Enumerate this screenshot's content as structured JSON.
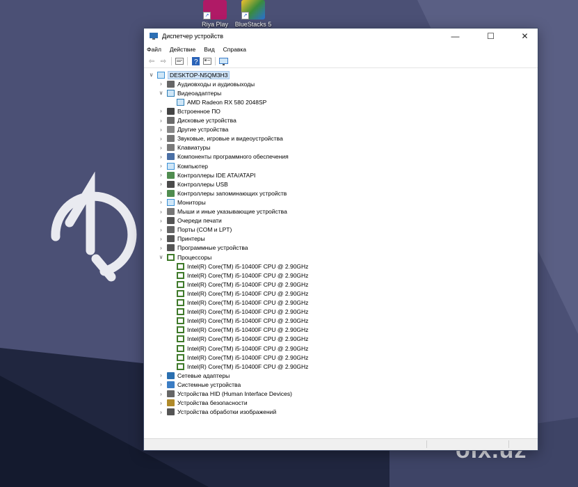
{
  "desktop": {
    "icons": [
      {
        "label": "Riya Play",
        "icon": "riya-play-icon",
        "color": "#b01a66"
      },
      {
        "label": "BlueStacks 5",
        "icon": "bluestacks-icon",
        "color": "#3b8c3b"
      }
    ],
    "watermark": "olx.uz"
  },
  "window": {
    "title": "Диспетчер устройств",
    "menu": [
      "Файл",
      "Действие",
      "Вид",
      "Справка"
    ],
    "toolbar_icons": [
      "back-icon",
      "forward-icon",
      "properties-icon",
      "help-icon",
      "update-driver-icon",
      "scan-hardware-icon"
    ],
    "tree": {
      "root": "DESKTOP-N5QM3H3",
      "items": [
        {
          "label": "Аудиовходы и аудиовыходы",
          "level": 1,
          "state": "collapsed",
          "icon": "audio-io-icon"
        },
        {
          "label": "Видеоадаптеры",
          "level": 1,
          "state": "expanded",
          "icon": "display-adapter-icon"
        },
        {
          "label": "AMD Radeon RX 580 2048SP",
          "level": 2,
          "state": "leaf",
          "icon": "display-adapter-icon"
        },
        {
          "label": "Встроенное ПО",
          "level": 1,
          "state": "collapsed",
          "icon": "firmware-icon"
        },
        {
          "label": "Дисковые устройства",
          "level": 1,
          "state": "collapsed",
          "icon": "disk-drive-icon"
        },
        {
          "label": "Другие устройства",
          "level": 1,
          "state": "collapsed",
          "icon": "other-devices-icon"
        },
        {
          "label": "Звуковые, игровые и видеоустройства",
          "level": 1,
          "state": "collapsed",
          "icon": "sound-icon"
        },
        {
          "label": "Клавиатуры",
          "level": 1,
          "state": "collapsed",
          "icon": "keyboard-icon"
        },
        {
          "label": "Компоненты программного обеспечения",
          "level": 1,
          "state": "collapsed",
          "icon": "software-component-icon"
        },
        {
          "label": "Компьютер",
          "level": 1,
          "state": "collapsed",
          "icon": "computer-icon"
        },
        {
          "label": "Контроллеры IDE ATA/ATAPI",
          "level": 1,
          "state": "collapsed",
          "icon": "ide-controller-icon"
        },
        {
          "label": "Контроллеры USB",
          "level": 1,
          "state": "collapsed",
          "icon": "usb-controller-icon"
        },
        {
          "label": "Контроллеры запоминающих устройств",
          "level": 1,
          "state": "collapsed",
          "icon": "storage-controller-icon"
        },
        {
          "label": "Мониторы",
          "level": 1,
          "state": "collapsed",
          "icon": "monitor-icon"
        },
        {
          "label": "Мыши и иные указывающие устройства",
          "level": 1,
          "state": "collapsed",
          "icon": "mouse-icon"
        },
        {
          "label": "Очереди печати",
          "level": 1,
          "state": "collapsed",
          "icon": "print-queue-icon"
        },
        {
          "label": "Порты (COM и LPT)",
          "level": 1,
          "state": "collapsed",
          "icon": "ports-icon"
        },
        {
          "label": "Принтеры",
          "level": 1,
          "state": "collapsed",
          "icon": "printer-icon"
        },
        {
          "label": "Программные устройства",
          "level": 1,
          "state": "collapsed",
          "icon": "software-device-icon"
        },
        {
          "label": "Процессоры",
          "level": 1,
          "state": "expanded",
          "icon": "processor-icon"
        },
        {
          "label": "Intel(R) Core(TM) i5-10400F CPU @ 2.90GHz",
          "level": 2,
          "state": "leaf",
          "icon": "processor-icon"
        },
        {
          "label": "Intel(R) Core(TM) i5-10400F CPU @ 2.90GHz",
          "level": 2,
          "state": "leaf",
          "icon": "processor-icon"
        },
        {
          "label": "Intel(R) Core(TM) i5-10400F CPU @ 2.90GHz",
          "level": 2,
          "state": "leaf",
          "icon": "processor-icon"
        },
        {
          "label": "Intel(R) Core(TM) i5-10400F CPU @ 2.90GHz",
          "level": 2,
          "state": "leaf",
          "icon": "processor-icon"
        },
        {
          "label": "Intel(R) Core(TM) i5-10400F CPU @ 2.90GHz",
          "level": 2,
          "state": "leaf",
          "icon": "processor-icon"
        },
        {
          "label": "Intel(R) Core(TM) i5-10400F CPU @ 2.90GHz",
          "level": 2,
          "state": "leaf",
          "icon": "processor-icon"
        },
        {
          "label": "Intel(R) Core(TM) i5-10400F CPU @ 2.90GHz",
          "level": 2,
          "state": "leaf",
          "icon": "processor-icon"
        },
        {
          "label": "Intel(R) Core(TM) i5-10400F CPU @ 2.90GHz",
          "level": 2,
          "state": "leaf",
          "icon": "processor-icon"
        },
        {
          "label": "Intel(R) Core(TM) i5-10400F CPU @ 2.90GHz",
          "level": 2,
          "state": "leaf",
          "icon": "processor-icon"
        },
        {
          "label": "Intel(R) Core(TM) i5-10400F CPU @ 2.90GHz",
          "level": 2,
          "state": "leaf",
          "icon": "processor-icon"
        },
        {
          "label": "Intel(R) Core(TM) i5-10400F CPU @ 2.90GHz",
          "level": 2,
          "state": "leaf",
          "icon": "processor-icon"
        },
        {
          "label": "Intel(R) Core(TM) i5-10400F CPU @ 2.90GHz",
          "level": 2,
          "state": "leaf",
          "icon": "processor-icon"
        },
        {
          "label": "Сетевые адаптеры",
          "level": 1,
          "state": "collapsed",
          "icon": "network-adapter-icon"
        },
        {
          "label": "Системные устройства",
          "level": 1,
          "state": "collapsed",
          "icon": "system-devices-icon"
        },
        {
          "label": "Устройства HID (Human Interface Devices)",
          "level": 1,
          "state": "collapsed",
          "icon": "hid-icon"
        },
        {
          "label": "Устройства безопасности",
          "level": 1,
          "state": "collapsed",
          "icon": "security-device-icon"
        },
        {
          "label": "Устройства обработки изображений",
          "level": 1,
          "state": "collapsed",
          "icon": "imaging-device-icon"
        }
      ]
    }
  }
}
